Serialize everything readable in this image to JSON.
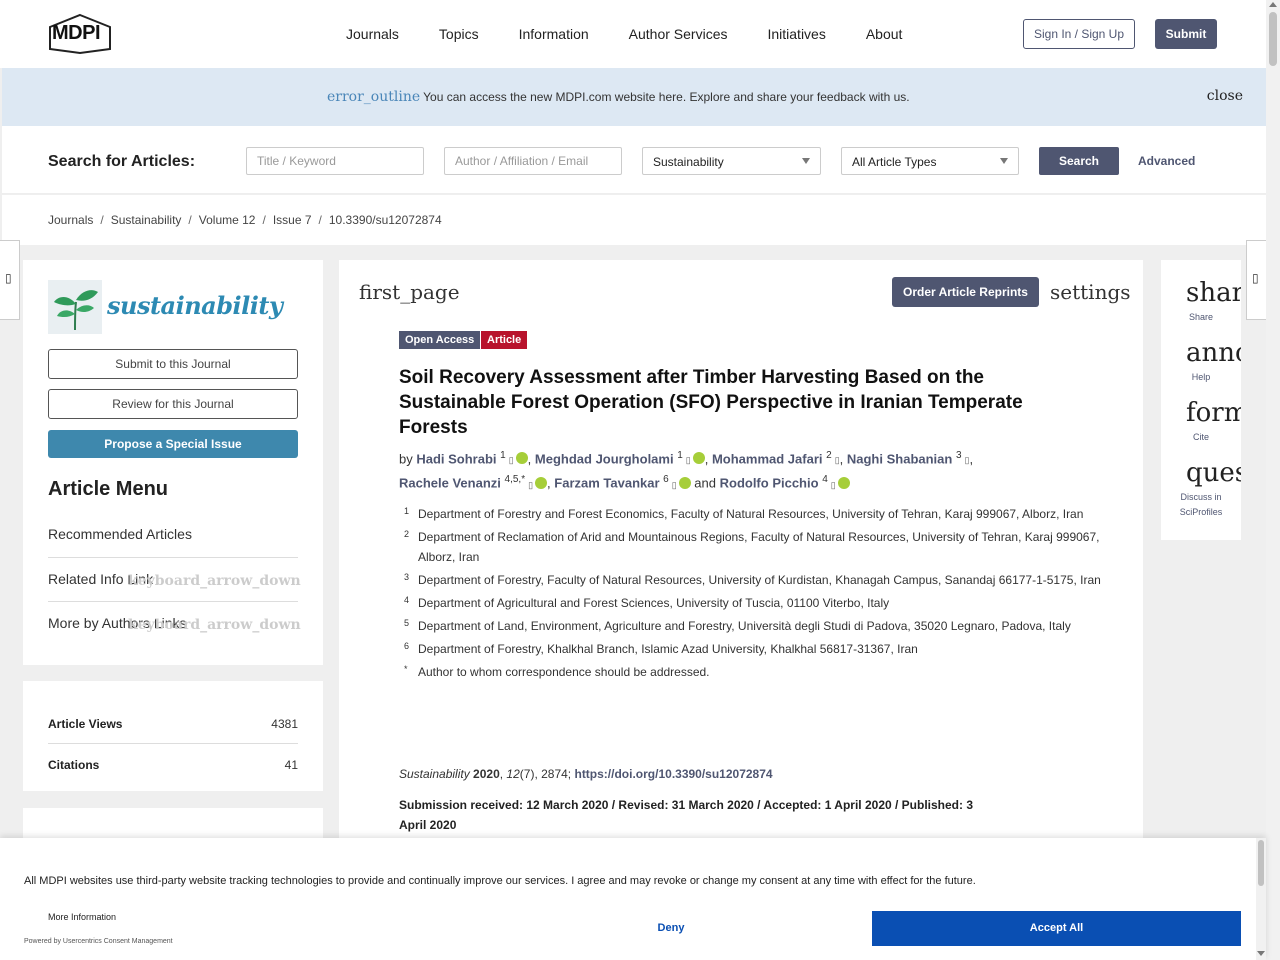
{
  "header": {
    "logo": "MDPI",
    "nav": [
      "Journals",
      "Topics",
      "Information",
      "Author Services",
      "Initiatives",
      "About"
    ],
    "signin": "Sign In / Sign Up",
    "submit": "Submit"
  },
  "banner": {
    "icon": "error_outline",
    "text_a": "You can access ",
    "text_b": "the new MDPI.com website here",
    "text_c": ". Explore and share your feedback with us.",
    "close": "close"
  },
  "search": {
    "label": "Search for Articles:",
    "title_placeholder": "Title / Keyword",
    "author_placeholder": "Author / Affiliation / Email",
    "journal": "Sustainability",
    "types": "All Article Types",
    "button": "Search",
    "advanced": "Advanced"
  },
  "breadcrumb": [
    "Journals",
    "Sustainability",
    "Volume 12",
    "Issue 7",
    "10.3390/su12072874"
  ],
  "left": {
    "journal_name": "sustainability",
    "submit_btn": "Submit to this Journal",
    "review_btn": "Review for this Journal",
    "propose_btn": "Propose a Special Issue",
    "menu_title": "Article Menu",
    "menu": [
      {
        "label": "Recommended Articles",
        "icon": ""
      },
      {
        "label": "Related Info Link",
        "icon": "keyboard_arrow_down"
      },
      {
        "label": "More by Authors Links",
        "icon": "keyboard_arrow_down"
      }
    ],
    "stats": [
      {
        "label": "Article Views",
        "value": "4381"
      },
      {
        "label": "Citations",
        "value": "41"
      }
    ]
  },
  "article": {
    "first_page": "first_page",
    "reprints": "Order Article Reprints",
    "settings": "settings",
    "badge_oa": "Open Access",
    "badge_type": "Article",
    "title": "Soil Recovery Assessment after Timber Harvesting Based on the Sustainable Forest Operation (SFO) Perspective in Iranian Temperate Forests",
    "by": "by ",
    "authors": [
      {
        "name": "Hadi Sohrabi",
        "sup": "1",
        "orcid": true,
        "sep": ", "
      },
      {
        "name": "Meghdad Jourgholami",
        "sup": "1",
        "orcid": true,
        "sep": ", "
      },
      {
        "name": "Mohammad Jafari",
        "sup": "2",
        "orcid": false,
        "sep": ", "
      },
      {
        "name": "Naghi Shabanian",
        "sup": "3",
        "orcid": false,
        "sep": ","
      },
      {
        "name": "Rachele Venanzi",
        "sup": "4,5,*",
        "orcid": true,
        "sep": ", "
      },
      {
        "name": "Farzam Tavankar",
        "sup": "6",
        "orcid": true,
        "sep": " and "
      },
      {
        "name": "Rodolfo Picchio",
        "sup": "4",
        "orcid": true,
        "sep": ""
      }
    ],
    "affiliations": [
      {
        "n": "1",
        "text": "Department of Forestry and Forest Economics, Faculty of Natural Resources, University of Tehran, Karaj 999067, Alborz, Iran"
      },
      {
        "n": "2",
        "text": "Department of Reclamation of Arid and Mountainous Regions, Faculty of Natural Resources, University of Tehran, Karaj 999067, Alborz, Iran"
      },
      {
        "n": "3",
        "text": "Department of Forestry, Faculty of Natural Resources, University of Kurdistan, Khanagah Campus, Sanandaj 66177-1-5175, Iran"
      },
      {
        "n": "4",
        "text": "Department of Agricultural and Forest Sciences, University of Tuscia, 01100 Viterbo, Italy"
      },
      {
        "n": "5",
        "text": "Department of Land, Environment, Agriculture and Forestry, Università degli Studi di Padova, 35020 Legnaro, Padova, Italy"
      },
      {
        "n": "6",
        "text": "Department of Forestry, Khalkhal Branch, Islamic Azad University, Khalkhal 56817-31367, Iran"
      },
      {
        "n": "*",
        "text": "Author to whom correspondence should be addressed."
      }
    ],
    "cite_journal": "Sustainability",
    "cite_year": " 2020",
    "cite_sep": ", ",
    "cite_vol": "12",
    "cite_rest": "(7), 2874; ",
    "cite_doi": "https://doi.org/10.3390/su12072874",
    "dates": "Submission received: 12 March 2020 / Revised: 31 March 2020 / Accepted: 1 April 2020 / Published: 3 April 2020"
  },
  "right": [
    {
      "icon": "share",
      "label": "Share"
    },
    {
      "icon": "announcement",
      "label": "Help"
    },
    {
      "icon": "format_quote",
      "label": "Cite"
    },
    {
      "icon": "question_answer",
      "label": "Discuss in SciProfiles"
    }
  ],
  "cookie": {
    "text": "All MDPI websites use third-party website tracking technologies to provide and continually improve our services. I agree and may revoke or change my consent at any time with effect for the future.",
    "more": "More Information",
    "powered": "Powered by Usercentrics Consent Management",
    "deny": "Deny",
    "accept": "Accept All"
  }
}
